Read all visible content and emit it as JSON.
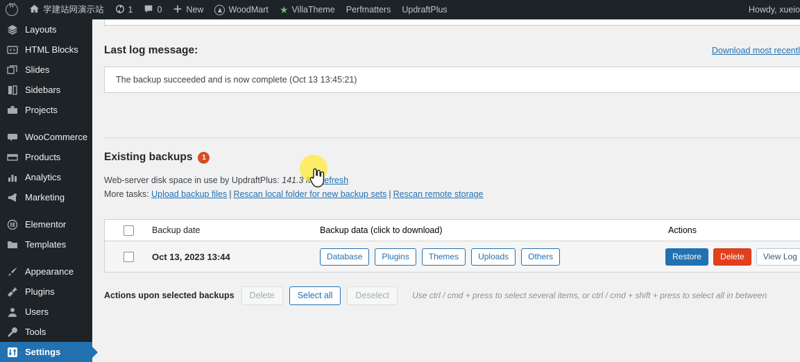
{
  "adminbar": {
    "logo_icon": "wordpress-logo-icon",
    "site_name": "学建站网演示站",
    "site_icon": "home-icon",
    "updates_icon": "updates-icon",
    "updates_count": "1",
    "comments_icon": "comment-bubble-icon",
    "comments_count": "0",
    "new_icon": "plus-icon",
    "new_label": "New",
    "woodmart_icon": "woodmart-icon",
    "woodmart_label": "WoodMart",
    "villatheme_icon": "star-icon",
    "villatheme_label": "VillaTheme",
    "perfmatters_label": "Perfmatters",
    "updraftplus_label": "UpdraftPlus",
    "howdy": "Howdy, xueio"
  },
  "sidebar": {
    "items": [
      {
        "label": "Layouts",
        "icon": "layers-icon",
        "current": false
      },
      {
        "label": "HTML Blocks",
        "icon": "code-icon",
        "current": false
      },
      {
        "label": "Slides",
        "icon": "slides-icon",
        "current": false
      },
      {
        "label": "Sidebars",
        "icon": "sidebar-icon",
        "current": false
      },
      {
        "label": "Projects",
        "icon": "portfolio-icon",
        "current": false
      },
      {
        "label": "WooCommerce",
        "icon": "woocommerce-icon",
        "current": false
      },
      {
        "label": "Products",
        "icon": "products-icon",
        "current": false
      },
      {
        "label": "Analytics",
        "icon": "chart-bars-icon",
        "current": false
      },
      {
        "label": "Marketing",
        "icon": "megaphone-icon",
        "current": false
      },
      {
        "label": "Elementor",
        "icon": "elementor-icon",
        "current": false
      },
      {
        "label": "Templates",
        "icon": "folder-icon",
        "current": false
      },
      {
        "label": "Appearance",
        "icon": "paintbrush-icon",
        "current": false
      },
      {
        "label": "Plugins",
        "icon": "plug-icon",
        "current": false
      },
      {
        "label": "Users",
        "icon": "user-icon",
        "current": false
      },
      {
        "label": "Tools",
        "icon": "wrench-icon",
        "current": false
      },
      {
        "label": "Settings",
        "icon": "sliders-icon",
        "current": true
      }
    ]
  },
  "main": {
    "last_log_title": "Last log message:",
    "download_link": "Download most recentl",
    "log_message": "The backup succeeded and is now complete (Oct 13 13:45:21)",
    "existing_backups_title": "Existing backups",
    "existing_backups_count": "1",
    "disk_space_label": "Web-server disk space in use by UpdraftPlus:",
    "disk_space_value": "141.3 MB",
    "refresh_link": "refresh",
    "more_tasks_label": "More tasks:",
    "upload_backup_link": "Upload backup files",
    "rescan_local_link": "Rescan local folder for new backup sets",
    "rescan_remote_link": "Rescan remote storage",
    "table": {
      "columns": [
        "Backup date",
        "Backup data (click to download)",
        "Actions"
      ],
      "rows": [
        {
          "date": "Oct 13, 2023 13:44",
          "data_buttons": [
            "Database",
            "Plugins",
            "Themes",
            "Uploads",
            "Others"
          ],
          "action_buttons": [
            "Restore",
            "Delete",
            "View Log"
          ]
        }
      ]
    },
    "bulk": {
      "label": "Actions upon selected backups",
      "delete": "Delete",
      "select_all": "Select all",
      "deselect": "Deselect",
      "hint": "Use ctrl / cmd + press to select several items, or ctrl / cmd + shift + press to select all in between"
    }
  },
  "colors": {
    "admin_dark": "#1d2327",
    "accent_blue": "#2271b1",
    "danger_red": "#e2401c",
    "badge_orange": "#d54e21",
    "highlight_yellow": "#ffe93a"
  }
}
